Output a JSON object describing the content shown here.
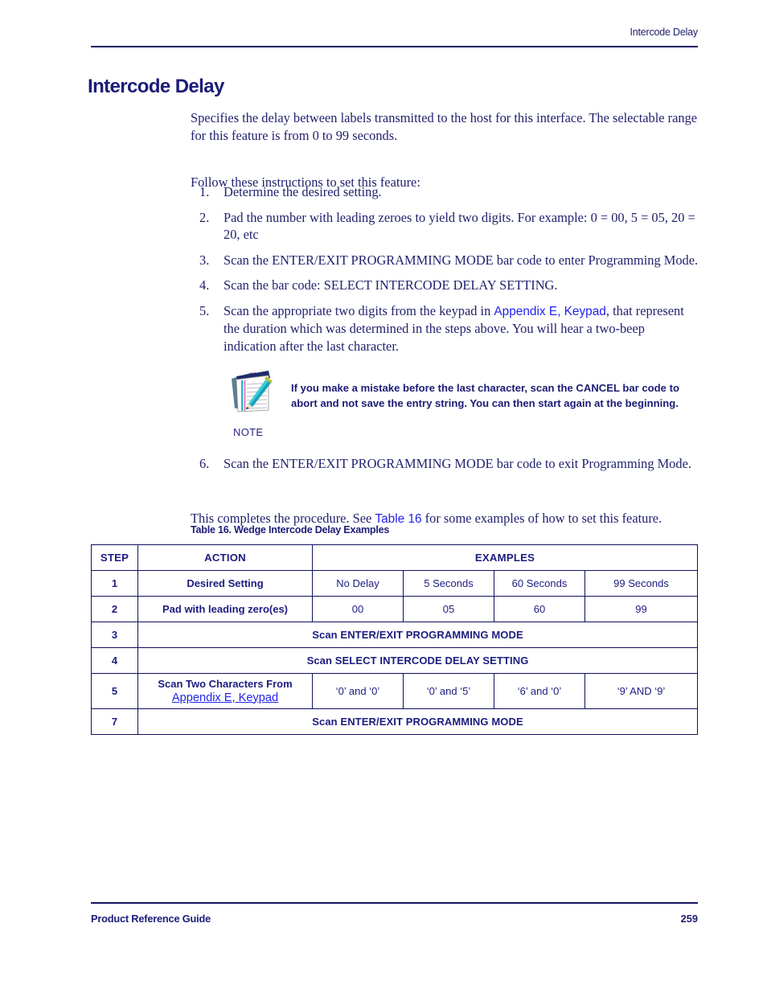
{
  "page": {
    "running_header": "Intercode Delay",
    "title": "Intercode Delay",
    "footer_left": "Product Reference Guide",
    "footer_page_number": "259",
    "rule_color": "#171765",
    "text_color": "#22226f",
    "link_color": "#2222ee",
    "heading_color": "#1c1c78"
  },
  "body": {
    "intro": "Specifies the delay between labels transmitted to the host for this interface. The selectable range for this feature is from 0 to 99 seconds.",
    "follow": "Follow these instructions to set this feature:",
    "steps": [
      {
        "num": "1.",
        "text": "Determine the desired setting."
      },
      {
        "num": "2.",
        "text": "Pad the number with leading zeroes to yield two digits. For example: 0 = 00, 5 = 05, 20 = 20, etc"
      },
      {
        "num": "3.",
        "text": "Scan the ENTER/EXIT PROGRAMMING MODE bar code to enter Programming Mode."
      },
      {
        "num": "4.",
        "text": "Scan the bar code: SELECT INTERCODE DELAY SETTING."
      }
    ],
    "step5": {
      "num": "5.",
      "text_before": "Scan the appropriate two digits from the keypad in ",
      "link": "Appendix E, Keypad",
      "text_after": ", that represent the duration which was determined in the steps above. You will hear a two-beep indication after the last character."
    },
    "step6": {
      "num": "6.",
      "text": "Scan the ENTER/EXIT PROGRAMMING MODE bar code to exit Programming Mode."
    },
    "closing": {
      "text_before": "This completes the procedure. See ",
      "link": "Table 16",
      "text_after": " for some examples of how to set this feature."
    }
  },
  "note": {
    "label": "NOTE",
    "icon": "notepad-pencil-icon",
    "text": "If you make a mistake before the last character, scan the CANCEL bar code to abort and not save the entry string. You can then start again at the beginning."
  },
  "table": {
    "caption": "Table 16. Wedge Intercode Delay Examples",
    "headers": [
      "STEP",
      "ACTION",
      "EXAMPLES"
    ],
    "rows": [
      {
        "kind": "data",
        "step": "1",
        "action": "Desired Setting",
        "values": [
          "No Delay",
          "5 Seconds",
          "60 Seconds",
          "99 Seconds"
        ]
      },
      {
        "kind": "data",
        "step": "2",
        "action": "Pad with leading zero(es)",
        "values": [
          "00",
          "05",
          "60",
          "99"
        ]
      },
      {
        "kind": "span",
        "step": "3",
        "action": "Scan ENTER/EXIT PROGRAMMING MODE"
      },
      {
        "kind": "span",
        "step": "4",
        "action": "Scan SELECT INTERCODE DELAY SETTING"
      },
      {
        "kind": "data-link",
        "step": "5",
        "action": "Scan Two Characters From",
        "action_link": "Appendix E, Keypad",
        "values": [
          "‘0’ and ‘0’",
          "‘0’ and ‘5’",
          "‘6’ and ‘0’",
          "‘9’ AND ‘9’"
        ]
      },
      {
        "kind": "span",
        "step": "7",
        "action": "Scan ENTER/EXIT PROGRAMMING MODE"
      }
    ]
  }
}
